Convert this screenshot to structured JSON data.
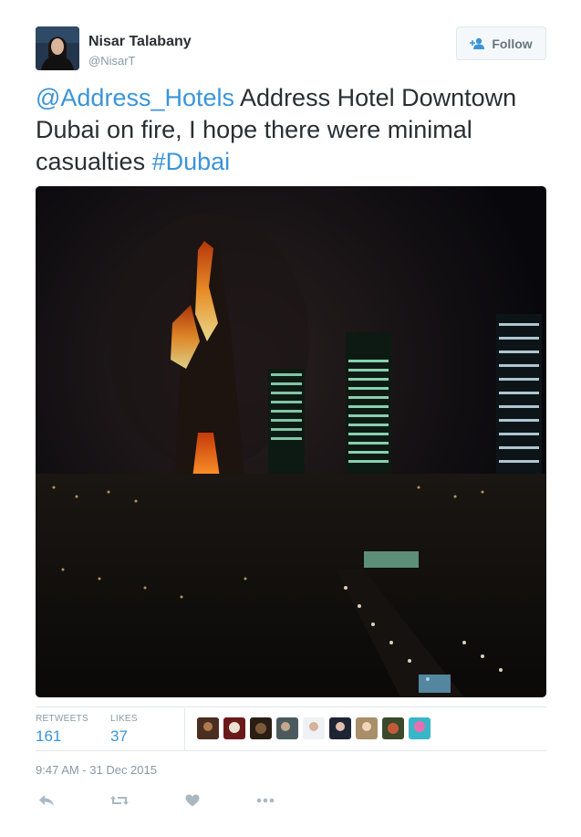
{
  "user": {
    "name": "Nisar Talabany",
    "handle": "@NisarT",
    "avatar_icon": "user-avatar"
  },
  "follow": {
    "label": "Follow",
    "icon": "add-user-icon"
  },
  "tweet": {
    "mention": "@Address_Hotels",
    "text_mid": " Address Hotel Downtown Dubai on fire, I hope there were minimal casualties ",
    "hashtag": "#Dubai"
  },
  "media": {
    "image_icon": "photo-burning-skyscraper"
  },
  "stats": {
    "retweets_label": "RETWEETS",
    "retweets_value": "161",
    "likes_label": "LIKES",
    "likes_value": "37"
  },
  "timestamp": "9:47 AM - 31 Dec 2015",
  "actions": [
    {
      "name": "reply-icon"
    },
    {
      "name": "retweet-icon"
    },
    {
      "name": "like-icon"
    },
    {
      "name": "more-icon"
    }
  ],
  "colors": {
    "link": "#3b94d9",
    "text": "#292f33",
    "muted": "#8899a6",
    "border": "#e1e8ed"
  }
}
